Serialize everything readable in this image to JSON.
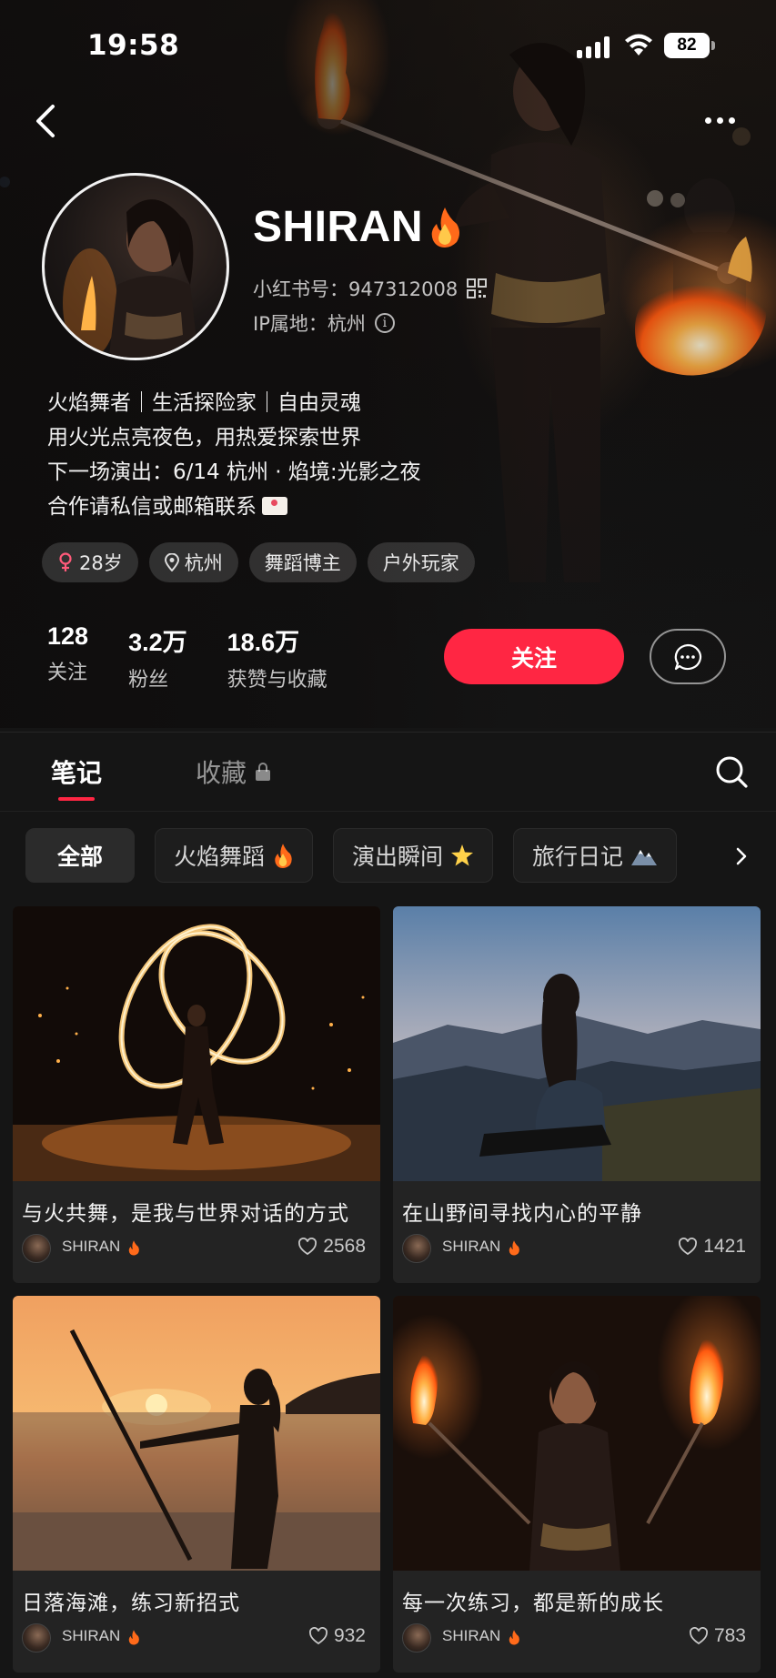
{
  "status_bar": {
    "time": "19:58",
    "battery": "82"
  },
  "profile": {
    "name": "SHIRAN",
    "red_id": "小红书号：947312008",
    "ip_location": "IP属地：杭州",
    "bio": [
      "火焰舞者｜生活探险家｜自由灵魂",
      "用火光点亮夜色，用热爱探索世界",
      "下一场演出：6/14 杭州 · 焰境:光影之夜",
      "合作请私信或邮箱联系"
    ],
    "tags": [
      {
        "icon": "gender-female-icon",
        "label": "28岁"
      },
      {
        "icon": "location-pin-icon",
        "label": "杭州"
      },
      {
        "icon": "",
        "label": "舞蹈博主"
      },
      {
        "icon": "",
        "label": "户外玩家"
      }
    ],
    "stats": [
      {
        "num": "128",
        "label": "关注"
      },
      {
        "num": "3.2万",
        "label": "粉丝"
      },
      {
        "num": "18.6万",
        "label": "获赞与收藏"
      }
    ],
    "follow_label": "关注"
  },
  "tabs": {
    "notes": "笔记",
    "favorites": "收藏"
  },
  "chips": [
    {
      "label": "全部",
      "emoji": ""
    },
    {
      "label": "火焰舞蹈",
      "emoji": "fire-emoji"
    },
    {
      "label": "演出瞬间",
      "emoji": "star-emoji"
    },
    {
      "label": "旅行日记",
      "emoji": "mountain-emoji"
    }
  ],
  "posts": [
    {
      "title": "与火共舞，是我与世界对话的方式",
      "author": "SHIRAN",
      "likes": "2568"
    },
    {
      "title": "在山野间寻找内心的平静",
      "author": "SHIRAN",
      "likes": "1421"
    },
    {
      "title": "日落海滩，练习新招式",
      "author": "SHIRAN",
      "likes": "932"
    },
    {
      "title": "每一次练习，都是新的成长",
      "author": "SHIRAN",
      "likes": "783"
    }
  ],
  "colors": {
    "accent": "#ff2643",
    "background": "#151515",
    "card": "#232323"
  }
}
